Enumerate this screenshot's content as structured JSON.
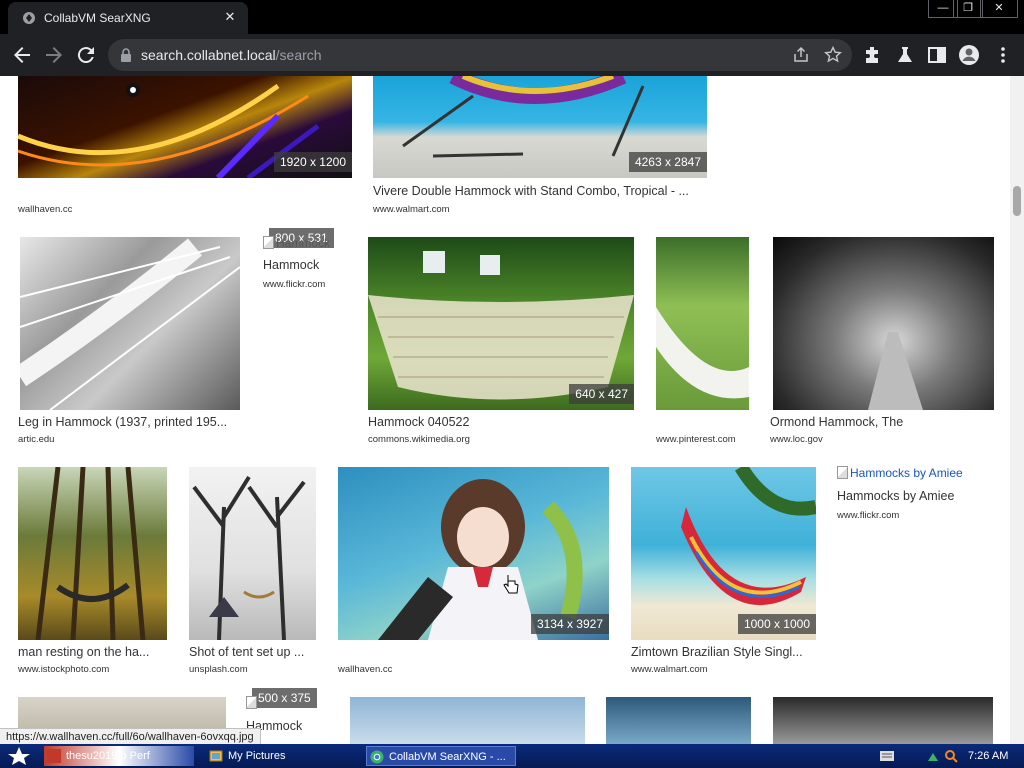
{
  "browser": {
    "tab_title": "CollabVM SearXNG",
    "tab_close": "✕",
    "url_host": "search.collabnet.local",
    "url_path": "/search",
    "window_min": "—",
    "window_max": "❐",
    "window_close": "✕"
  },
  "results": {
    "row1": [
      {
        "title": "",
        "url": "wallhaven.cc",
        "resolution": "1920 x 1200"
      },
      {
        "title": "Vivere Double Hammock with Stand Combo, Tropical - ...",
        "url": "www.walmart.com",
        "resolution": "4263 x 2847"
      }
    ],
    "row2": [
      {
        "title": "Leg in Hammock (1937, printed 195...",
        "url": "artic.edu"
      },
      {
        "title": "Hammock",
        "url": "www.flickr.com",
        "resolution": "800 x 531",
        "broken_alt": "Hammock"
      },
      {
        "title": "Hammock 040522",
        "url": "commons.wikimedia.org",
        "resolution": "640 x 427"
      },
      {
        "title": "",
        "url": "www.pinterest.com"
      },
      {
        "title": "Ormond Hammock, The",
        "url": "www.loc.gov"
      }
    ],
    "row3": [
      {
        "title": "man resting on the ha...",
        "url": "www.istockphoto.com"
      },
      {
        "title": "Shot of tent set up ...",
        "url": "unsplash.com"
      },
      {
        "title": "",
        "url": "wallhaven.cc",
        "resolution": "3134 x 3927"
      },
      {
        "title": "Zimtown Brazilian Style Singl...",
        "url": "www.walmart.com",
        "resolution": "1000 x 1000"
      },
      {
        "title": "Hammocks by Amiee",
        "url": "www.flickr.com",
        "broken_alt": "Hammocks by Amiee"
      }
    ],
    "row4": [
      {
        "resolution": "500 x 375",
        "broken_alt": "Hammock"
      }
    ]
  },
  "status_bubble": "https://w.wallhaven.cc/full/6o/wallhaven-6ovxqq.jpg",
  "taskbar": {
    "task1": "thesu2019.b  Perf",
    "task2": "My Pictures",
    "task3": "CollabVM SearXNG - ...",
    "clock": "7:26 AM"
  },
  "colors": {
    "chrome_dark": "#202124",
    "taskbar": "#0a2a7a",
    "resolution_badge": "#3c3c3c"
  }
}
